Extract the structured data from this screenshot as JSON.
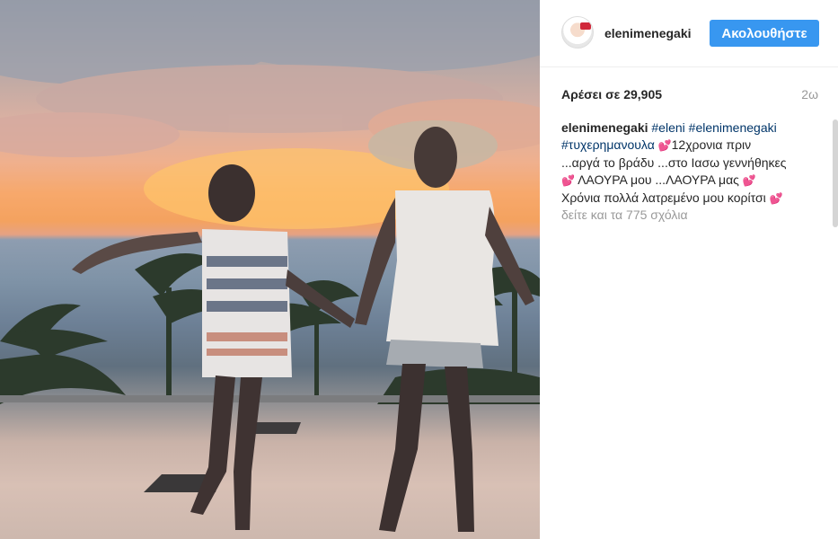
{
  "post": {
    "image_alt": "Two figures holding hands at sunset by an infinity pool",
    "username": "elenimenegaki",
    "follow_label": "Ακολουθήστε",
    "likes": "Αρέσει σε 29,905",
    "time": "2ω",
    "caption": {
      "user": "elenimenegaki",
      "tag1": "#eleni",
      "tag2": "#elenimenegaki",
      "tag3": "#τυχερημανουλα",
      "text1": "12χρονια πριν",
      "text2": "...αργά το βράδυ ...στο Ιασω γεννήθηκες",
      "text3": "ΛΑΟΥΡΑ μου ...ΛΑΟΥΡΑ μας",
      "text4": "Χρόνια πολλά λατρεμένο μου κορίτσι",
      "heart_glyph": "💕"
    },
    "comments_link": "δείτε και τα 775 σχόλια"
  },
  "colors": {
    "follow_button": "#3897f0",
    "hashtag": "#003569",
    "muted": "#999999"
  }
}
